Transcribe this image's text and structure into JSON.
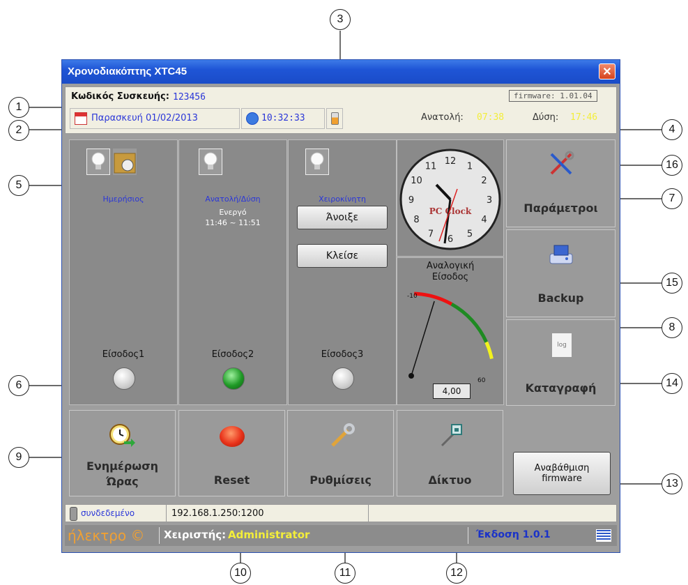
{
  "window": {
    "title": "Χρονοδιακόπτης XTC45",
    "close": "✕"
  },
  "info": {
    "device_label": "Κωδικός Συσκευής:",
    "device_code": "123456",
    "firmware": "firmware: 1.01.04",
    "date": "Παρασκευή 01/02/2013",
    "time": "10:32:33",
    "sunrise_label": "Ανατολή:",
    "sunrise": "07:38",
    "sunset_label": "Δύση:",
    "sunset": "17:46"
  },
  "inputs": [
    {
      "mode": "Ημερήσιος",
      "status": "",
      "range": "",
      "label": "Είσοδος1",
      "led": "#d6d6d6"
    },
    {
      "mode": "Ανατολή/Δύση",
      "status": "Ενεργό",
      "range": "11:46 ~ 11:51",
      "label": "Είσοδος2",
      "led": "#1f9a26"
    },
    {
      "mode": "Χειροκίνητη",
      "status": "",
      "range": "",
      "label": "Είσοδος3",
      "led": "#d6d6d6"
    }
  ],
  "manual": {
    "open": "Άνοιξε",
    "close": "Κλείσε"
  },
  "clock": {
    "numbers": [
      "12",
      "1",
      "2",
      "3",
      "4",
      "5",
      "6",
      "7",
      "8",
      "9",
      "10",
      "11"
    ],
    "brand": "PC Clock",
    "time": "10:32:33"
  },
  "analog": {
    "title_line1": "Αναλογική",
    "title_line2": "Είσοδος",
    "min": "-10",
    "max": "60",
    "value": "4,00",
    "value_num": 4
  },
  "side": {
    "params": "Παράμετροι",
    "backup": "Backup",
    "log": "Καταγραφή",
    "log_icon": "log"
  },
  "bottom": {
    "sync_line1": "Ενημέρωση",
    "sync_line2": "Ώρας",
    "reset": "Reset",
    "settings": "Ρυθμίσεις",
    "network": "Δίκτυο",
    "upgrade_line1": "Αναβάθμιση",
    "upgrade_line2": "firmware"
  },
  "status": {
    "connection": "συνδεδεμένο",
    "address": "192.168.1.250:1200"
  },
  "footer": {
    "brand": "ήλεκτρο ©",
    "operator_label": "Χειριστής:",
    "operator": "Administrator",
    "version": "Έκδοση 1.0.1"
  },
  "callouts": [
    "1",
    "2",
    "3",
    "4",
    "5",
    "6",
    "7",
    "8",
    "9",
    "10",
    "11",
    "12",
    "13",
    "14",
    "15",
    "16"
  ],
  "colors": {
    "titlebar": "#1f55d6",
    "accent_blue": "#2a36d8",
    "accent_yellow": "#f3ee3a",
    "led_on": "#1f9a26"
  }
}
